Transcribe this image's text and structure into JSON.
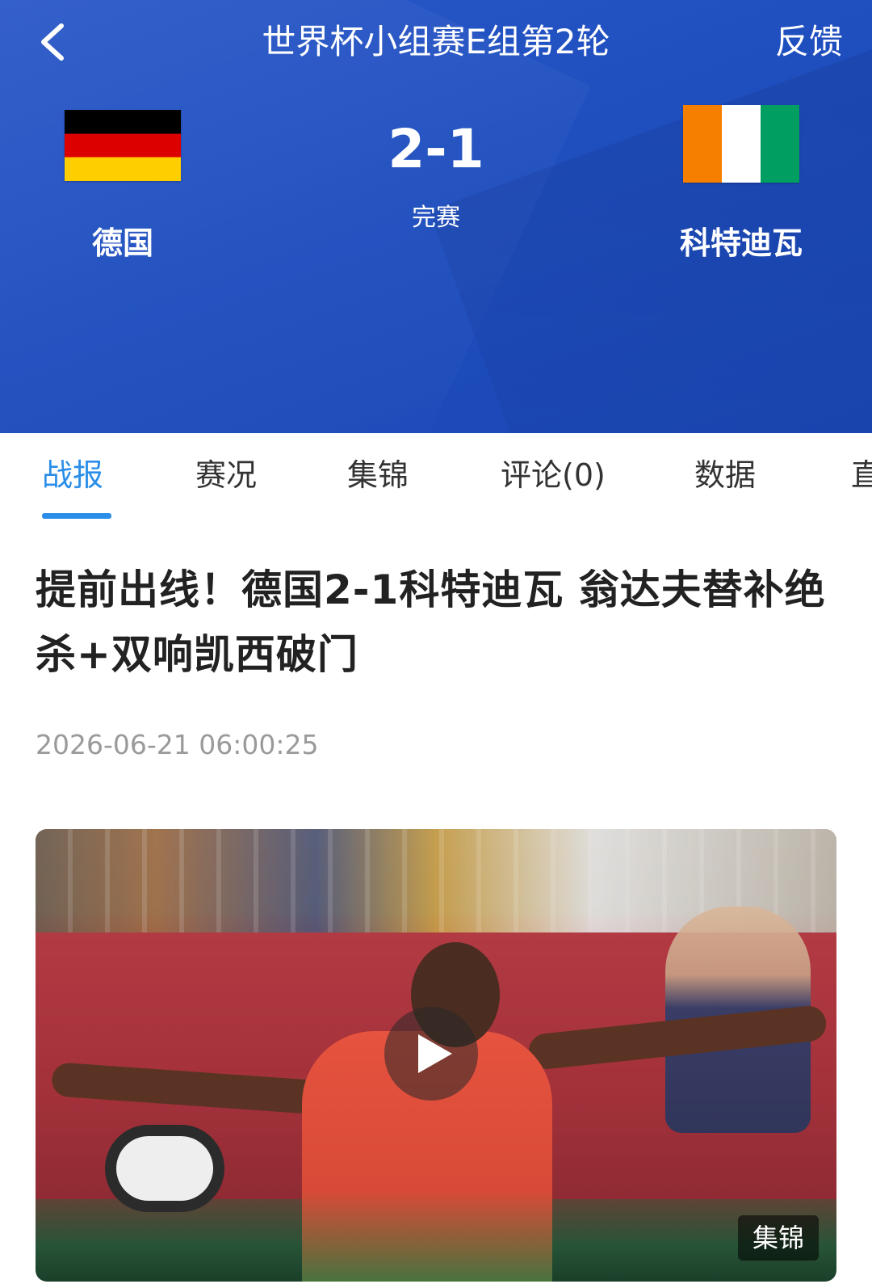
{
  "nav": {
    "title": "世界杯小组赛E组第2轮",
    "feedback_label": "反馈",
    "back_icon": "chevron-left-icon"
  },
  "match": {
    "home": {
      "name": "德国",
      "flag": "germany-flag"
    },
    "away": {
      "name": "科特迪瓦",
      "flag": "cote-divoire-flag"
    },
    "score": "2-1",
    "status": "完赛"
  },
  "tabs": [
    {
      "label": "战报",
      "active": true
    },
    {
      "label": "赛况",
      "active": false
    },
    {
      "label": "集锦",
      "active": false
    },
    {
      "label": "评论(0)",
      "active": false
    },
    {
      "label": "数据",
      "active": false
    },
    {
      "label": "直",
      "active": false
    }
  ],
  "article": {
    "headline": "提前出线！德国2-1科特迪瓦 翁达夫替补绝杀+双响凯西破门",
    "timestamp": "2026-06-21 06:00:25",
    "video": {
      "badge": "集锦",
      "play_icon": "play-icon"
    }
  },
  "colors": {
    "header_blue": "#1f4fbf",
    "accent": "#2a8ee8",
    "timestamp_gray": "#9a9a9a"
  }
}
